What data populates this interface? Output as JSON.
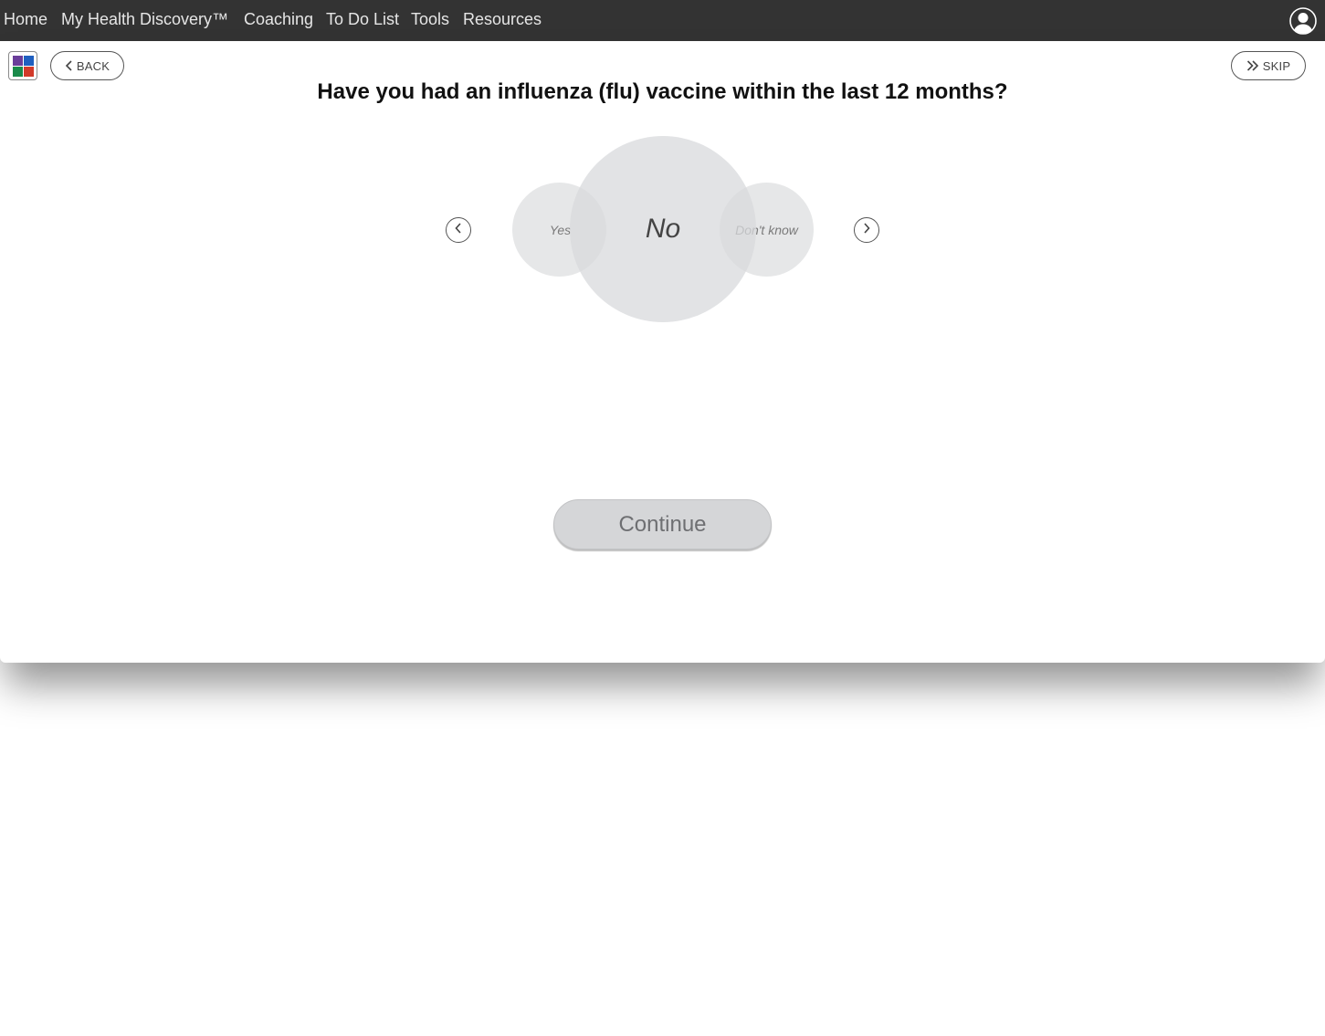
{
  "nav": {
    "items": [
      {
        "label": "Home"
      },
      {
        "label": "My Health Discovery™"
      },
      {
        "label": "Coaching"
      },
      {
        "label": "To Do List"
      },
      {
        "label": "Tools"
      },
      {
        "label": "Resources"
      }
    ],
    "user_icon": "user-avatar-icon"
  },
  "toolbar": {
    "app_grid_icon": "app-grid-icon",
    "app_grid_colors": [
      "#6a3d9a",
      "#1f5fbf",
      "#1a8a4a",
      "#d23a2a"
    ],
    "back_label": "BACK",
    "skip_label": "SKIP"
  },
  "question": {
    "text": "Have you had an influenza (flu) vaccine within the last 12 months?"
  },
  "options": {
    "items": [
      {
        "label": "Yes"
      },
      {
        "label": "No"
      },
      {
        "label": "Don't know"
      }
    ],
    "selected": "No"
  },
  "continue_label": "Continue",
  "colors": {
    "nav_bg": "#333333",
    "bubble": "#d8d9dc",
    "continue_bg": "#d5d6d8"
  }
}
